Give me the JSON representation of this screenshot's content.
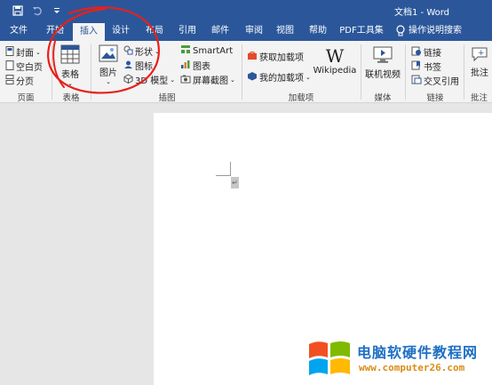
{
  "window": {
    "title": "文档1 - Word"
  },
  "tabs": [
    "文件",
    "开始",
    "插入",
    "设计",
    "布局",
    "引用",
    "邮件",
    "审阅",
    "视图",
    "帮助",
    "PDF工具集",
    "操作说明搜索"
  ],
  "active_tab": "插入",
  "ribbon": {
    "pages": {
      "cover": "封面",
      "blank": "空白页",
      "break": "分页",
      "label": "页面"
    },
    "tables": {
      "table": "表格",
      "label": "表格"
    },
    "illustrations": {
      "picture": "图片",
      "shapes": "形状",
      "icons": "图标",
      "model3d": "3D 模型",
      "smartart": "SmartArt",
      "chart": "图表",
      "screenshot": "屏幕截图",
      "label": "插图"
    },
    "addins": {
      "get": "获取加载项",
      "my": "我的加载项",
      "wikipedia": "Wikipedia",
      "label": "加载项"
    },
    "media": {
      "online_video": "联机视频",
      "label": "媒体"
    },
    "links": {
      "link": "链接",
      "bookmark": "书签",
      "cross_ref": "交叉引用",
      "label": "链接"
    },
    "comments": {
      "comment": "批注",
      "label": "批注"
    }
  },
  "document": {
    "paragraph_mark": "↵"
  },
  "watermark": {
    "title": "电脑软硬件教程网",
    "url": "www.computer26.com"
  },
  "colors": {
    "accent": "#2b579a",
    "annotation": "#e8201a"
  }
}
